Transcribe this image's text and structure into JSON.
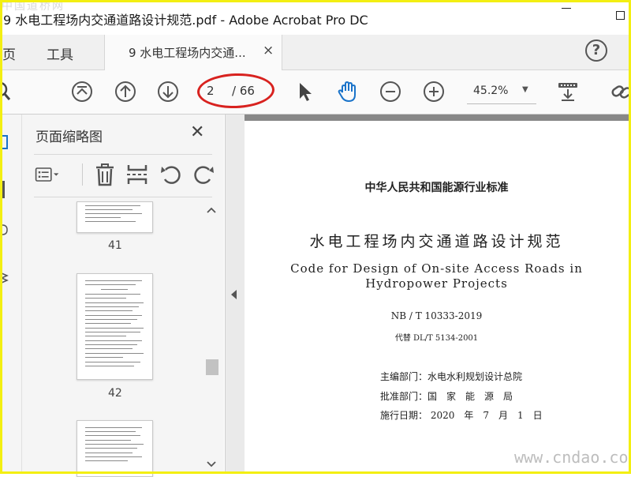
{
  "window": {
    "title": "9 水电工程场内交通道路设计规范.pdf - Adobe Acrobat Pro DC",
    "watermark_top": "中国道桥网"
  },
  "tabs": {
    "home_label": "主页",
    "tools_label": "工具",
    "doc_tab_label": "9 水电工程场内交通...",
    "close_glyph": "×",
    "help_glyph": "?"
  },
  "toolbar": {
    "current_page": "2",
    "total_pages": "/ 66",
    "zoom": "45.2%",
    "accent_color": "#d8221f"
  },
  "panel": {
    "title": "页面缩略图",
    "close_glyph": "✕",
    "thumbnails": [
      {
        "label": "41"
      },
      {
        "label": "42"
      },
      {
        "label": ""
      }
    ]
  },
  "document": {
    "line1": "中华人民共和国能源行业标准",
    "line2": "水电工程场内交通道路设计规范",
    "line3": "Code for Design of On-site Access Roads in",
    "line4": "Hydropower Projects",
    "line5": "NB / T 10333-2019",
    "line6": "代替 DL/T 5134-2001",
    "line7": "主编部门：水电水利规划设计总院",
    "line8": "批准部门：国　家　能　源　局",
    "line9": "施行日期： 2020　年　7　月　1　日"
  },
  "watermark": "www.cndao.com",
  "icons": {
    "toolbar": [
      "search-icon",
      "first-page-icon",
      "prev-page-icon",
      "next-page-icon",
      "select-cursor-icon",
      "hand-tool-icon",
      "zoom-out-icon",
      "zoom-in-icon",
      "download-icon",
      "link-icon"
    ],
    "panel": [
      "thumbnail-options-icon",
      "trash-icon",
      "extract-page-icon",
      "rotate-left-icon",
      "rotate-right-icon"
    ]
  }
}
